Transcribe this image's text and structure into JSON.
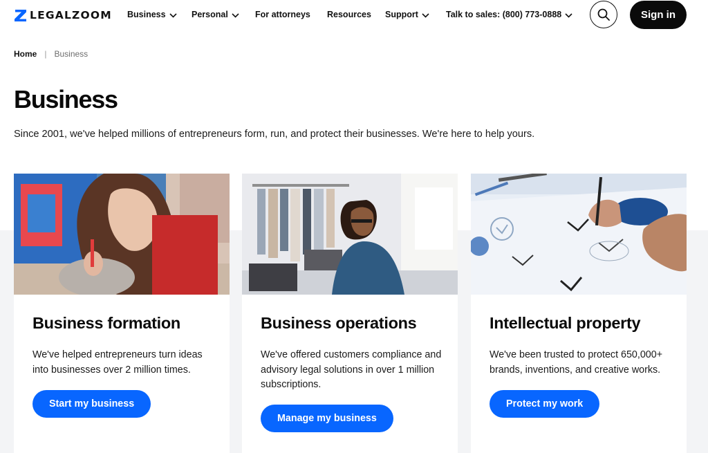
{
  "header": {
    "logo_text": "LEGALZOOM",
    "nav": [
      {
        "label": "Business",
        "has_dropdown": true
      },
      {
        "label": "Personal",
        "has_dropdown": true
      },
      {
        "label": "For attorneys",
        "has_dropdown": false
      },
      {
        "label": "Resources",
        "has_dropdown": false
      },
      {
        "label": "Support",
        "has_dropdown": true
      },
      {
        "label": "Talk to sales: (800) 773-0888",
        "has_dropdown": true
      }
    ],
    "search_icon": "search-icon",
    "signin_label": "Sign in"
  },
  "breadcrumb": {
    "home": "Home",
    "separator": "|",
    "current": "Business"
  },
  "page": {
    "title": "Business",
    "intro": "Since 2001, we've helped millions of entrepreneurs form, run, and protect their businesses. We're here to help yours."
  },
  "cards": [
    {
      "title": "Business formation",
      "description": "We've helped entrepreneurs turn ideas into businesses over 2 million times.",
      "button": "Start my business",
      "image": "woman-crafting-pottery-photo"
    },
    {
      "title": "Business operations",
      "description": "We've offered customers compliance and advisory legal solutions in over 1 million subscriptions.",
      "button": "Manage my business",
      "image": "woman-working-at-laptop-in-clothing-studio-photo"
    },
    {
      "title": "Intellectual property",
      "description": "We've been trusted to protect 650,000+ brands, inventions, and creative works.",
      "button": "Protect my work",
      "image": "hands-sketching-logo-designs-photo"
    }
  ],
  "colors": {
    "brand_blue": "#0866ff",
    "text_dark": "#0a0a0a",
    "band_gray": "#f3f4f6",
    "signin_bg": "#0a0a0a"
  }
}
